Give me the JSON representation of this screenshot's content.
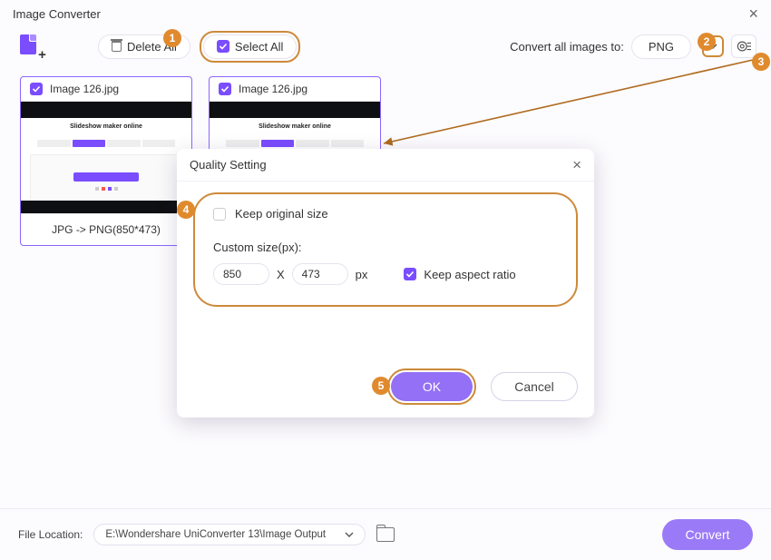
{
  "window": {
    "title": "Image Converter"
  },
  "toolbar": {
    "delete_all": "Delete All",
    "select_all": "Select All",
    "convert_to_label": "Convert all images to:",
    "format": "PNG"
  },
  "thumbs": [
    {
      "name": "Image 126.jpg",
      "caption": "Slideshow maker online",
      "convert_info": "JPG -> PNG(850*473)"
    },
    {
      "name": "Image 126.jpg",
      "caption": "Slideshow maker online",
      "convert_info": ""
    }
  ],
  "dialog": {
    "title": "Quality Setting",
    "keep_original": "Keep original size",
    "custom_label": "Custom size(px):",
    "width": "850",
    "sep": "X",
    "height": "473",
    "unit": "px",
    "keep_ratio": "Keep aspect ratio",
    "ok": "OK",
    "cancel": "Cancel"
  },
  "footer": {
    "label": "File Location:",
    "path": "E:\\Wondershare UniConverter 13\\Image Output",
    "convert": "Convert"
  },
  "badges": {
    "b1": "1",
    "b2": "2",
    "b3": "3",
    "b4": "4",
    "b5": "5"
  }
}
